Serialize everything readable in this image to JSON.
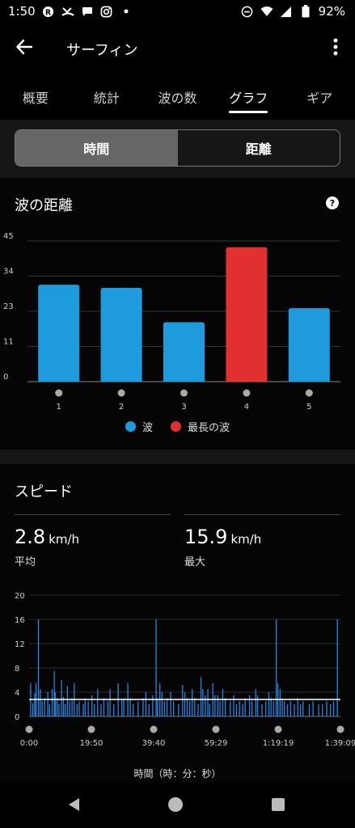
{
  "status": {
    "time": "1:50",
    "battery": "92%",
    "icons": [
      "r-badge-icon",
      "missed-call-icon",
      "chat-icon",
      "instagram-icon",
      "dot-icon",
      "dnd-icon",
      "wifi-icon",
      "signal-icon",
      "battery-icon"
    ]
  },
  "app_bar": {
    "title": "サーフィン",
    "back_icon": "arrow-left-icon",
    "more_icon": "more-vert-icon"
  },
  "tabs": [
    {
      "label": "概要",
      "active": false
    },
    {
      "label": "統計",
      "active": false
    },
    {
      "label": "波の数",
      "active": false
    },
    {
      "label": "グラフ",
      "active": true
    },
    {
      "label": "ギア",
      "active": false
    }
  ],
  "segmented": {
    "time_label": "時間",
    "distance_label": "距離",
    "selected": "時間"
  },
  "wave_card": {
    "title": "波の距離",
    "legend": [
      {
        "label": "波",
        "color": "#1e9bdc"
      },
      {
        "label": "最長の波",
        "color": "#e03030"
      }
    ]
  },
  "speed_card": {
    "title": "スピード",
    "avg_value": "2.8",
    "avg_unit": "km/h",
    "avg_label": "平均",
    "max_value": "15.9",
    "max_unit": "km/h",
    "max_label": "最大",
    "x_axis_label": "時間（時：分：秒）"
  },
  "chart_data": [
    {
      "type": "bar",
      "categories": [
        "1",
        "2",
        "3",
        "4",
        "5"
      ],
      "values": [
        31,
        30,
        19,
        43,
        23.5
      ],
      "highlight_index": 3,
      "yticks": [
        "0",
        "11",
        "23",
        "34",
        "45"
      ],
      "ylim": [
        0,
        45
      ],
      "grid": true,
      "colors": {
        "normal": "#1e9bdc",
        "highlight": "#e03030"
      }
    },
    {
      "type": "bar",
      "xticks": [
        "0:00",
        "19:50",
        "39:40",
        "59:29",
        "1:19:19",
        "1:39:09"
      ],
      "yticks": [
        "0",
        "4",
        "8",
        "12",
        "16",
        "20"
      ],
      "ylim": [
        0,
        20
      ],
      "average": 2.8,
      "max": 15.9,
      "grid": true,
      "color": "#1e88e5",
      "spikes": [
        [
          0.5,
          5.5
        ],
        [
          1.2,
          2.2
        ],
        [
          1.8,
          3.8
        ],
        [
          2.2,
          5.5
        ],
        [
          3.0,
          16.0
        ],
        [
          3.6,
          4.5
        ],
        [
          4.2,
          2.5
        ],
        [
          5.0,
          3.0
        ],
        [
          6.0,
          4.0
        ],
        [
          6.6,
          2.0
        ],
        [
          7.4,
          4.5
        ],
        [
          8.1,
          7.5
        ],
        [
          8.4,
          4.0
        ],
        [
          9.0,
          3.0
        ],
        [
          9.6,
          2.0
        ],
        [
          10.4,
          6.0
        ],
        [
          11.0,
          3.2
        ],
        [
          11.6,
          2.0
        ],
        [
          12.3,
          5.0
        ],
        [
          13.0,
          2.5
        ],
        [
          13.8,
          3.0
        ],
        [
          14.5,
          5.5
        ],
        [
          15.4,
          2.0
        ],
        [
          16.1,
          2.5
        ],
        [
          17.4,
          2.0
        ],
        [
          18.0,
          3.0
        ],
        [
          19.0,
          2.5
        ],
        [
          20.2,
          3.5
        ],
        [
          21.0,
          2.0
        ],
        [
          22.0,
          4.5
        ],
        [
          23.1,
          2.0
        ],
        [
          24.0,
          3.0
        ],
        [
          25.3,
          2.5
        ],
        [
          26.0,
          4.5
        ],
        [
          27.2,
          2.0
        ],
        [
          28.6,
          5.5
        ],
        [
          29.8,
          2.8
        ],
        [
          30.4,
          3.0
        ],
        [
          31.7,
          5.5
        ],
        [
          32.5,
          3.0
        ],
        [
          33.4,
          2.0
        ],
        [
          35.0,
          2.5
        ],
        [
          36.6,
          3.0
        ],
        [
          37.5,
          4.0
        ],
        [
          38.5,
          2.0
        ],
        [
          39.7,
          3.5
        ],
        [
          40.8,
          16.0
        ],
        [
          41.2,
          3.0
        ],
        [
          42.0,
          5.5
        ],
        [
          42.7,
          4.0
        ],
        [
          43.5,
          2.5
        ],
        [
          44.3,
          3.0
        ],
        [
          45.5,
          4.0
        ],
        [
          46.4,
          2.5
        ],
        [
          48.0,
          2.0
        ],
        [
          49.3,
          5.2
        ],
        [
          50.0,
          4.0
        ],
        [
          50.8,
          3.0
        ],
        [
          51.6,
          2.5
        ],
        [
          52.4,
          4.5
        ],
        [
          53.2,
          3.0
        ],
        [
          54.3,
          2.0
        ],
        [
          55.2,
          6.5
        ],
        [
          55.8,
          4.5
        ],
        [
          56.6,
          3.5
        ],
        [
          57.4,
          4.5
        ],
        [
          58.0,
          2.0
        ],
        [
          59.0,
          5.5
        ],
        [
          59.7,
          3.5
        ],
        [
          60.6,
          3.5
        ],
        [
          61.3,
          2.5
        ],
        [
          62.2,
          4.5
        ],
        [
          63.0,
          3.0
        ],
        [
          64.6,
          2.5
        ],
        [
          65.7,
          3.5
        ],
        [
          66.6,
          2.0
        ],
        [
          67.6,
          2.5
        ],
        [
          68.6,
          2.0
        ],
        [
          69.4,
          3.0
        ],
        [
          70.8,
          3.5
        ],
        [
          71.6,
          2.5
        ],
        [
          72.8,
          4.5
        ],
        [
          73.4,
          3.5
        ],
        [
          74.8,
          2.0
        ],
        [
          76.0,
          2.5
        ],
        [
          77.0,
          4.0
        ],
        [
          77.7,
          3.0
        ],
        [
          78.5,
          2.5
        ],
        [
          79.4,
          16.0
        ],
        [
          79.9,
          5.5
        ],
        [
          80.6,
          4.5
        ],
        [
          81.3,
          3.0
        ],
        [
          82.0,
          2.5
        ],
        [
          83.0,
          2.0
        ],
        [
          84.0,
          2.5
        ],
        [
          85.2,
          2.0
        ],
        [
          86.3,
          3.0
        ],
        [
          87.2,
          2.0
        ],
        [
          88.0,
          2.5
        ],
        [
          90.0,
          2.0
        ],
        [
          91.2,
          2.5
        ],
        [
          93.0,
          2.0
        ],
        [
          94.2,
          2.0
        ],
        [
          95.6,
          2.5
        ],
        [
          96.8,
          2.0
        ],
        [
          97.8,
          2.5
        ],
        [
          99.0,
          16.0
        ]
      ]
    }
  ]
}
